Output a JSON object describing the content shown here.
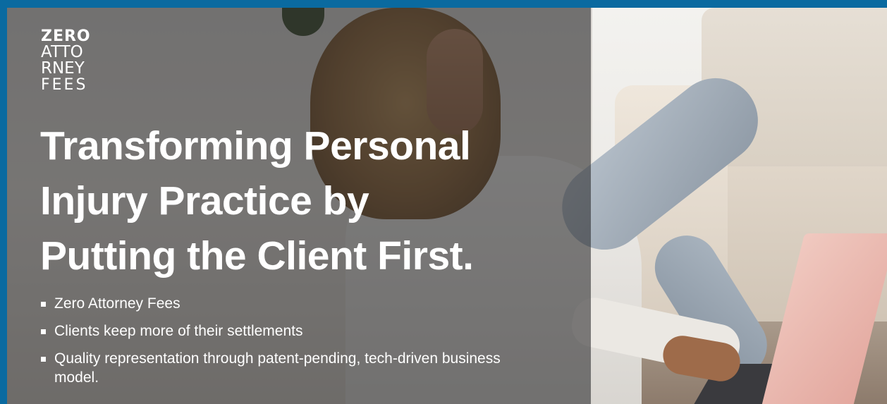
{
  "logo": {
    "line1": "ZERO",
    "line2": "ATTO",
    "line2b": "RNEY",
    "line3": "FEES",
    "text_lines": [
      "ZERO",
      "ATTORNEY",
      "FEES"
    ]
  },
  "headline": {
    "line1": "Transforming Personal",
    "line2": "Injury Practice by",
    "line3": "Putting the Client First."
  },
  "bullets": [
    "Zero Attorney Fees",
    "Clients keep more of their settlements",
    "Quality representation through patent-pending, tech-driven business model."
  ],
  "colors": {
    "border": "#0a6aa0",
    "text": "#ffffff",
    "overlay": "rgba(40,40,42,0.58)"
  }
}
